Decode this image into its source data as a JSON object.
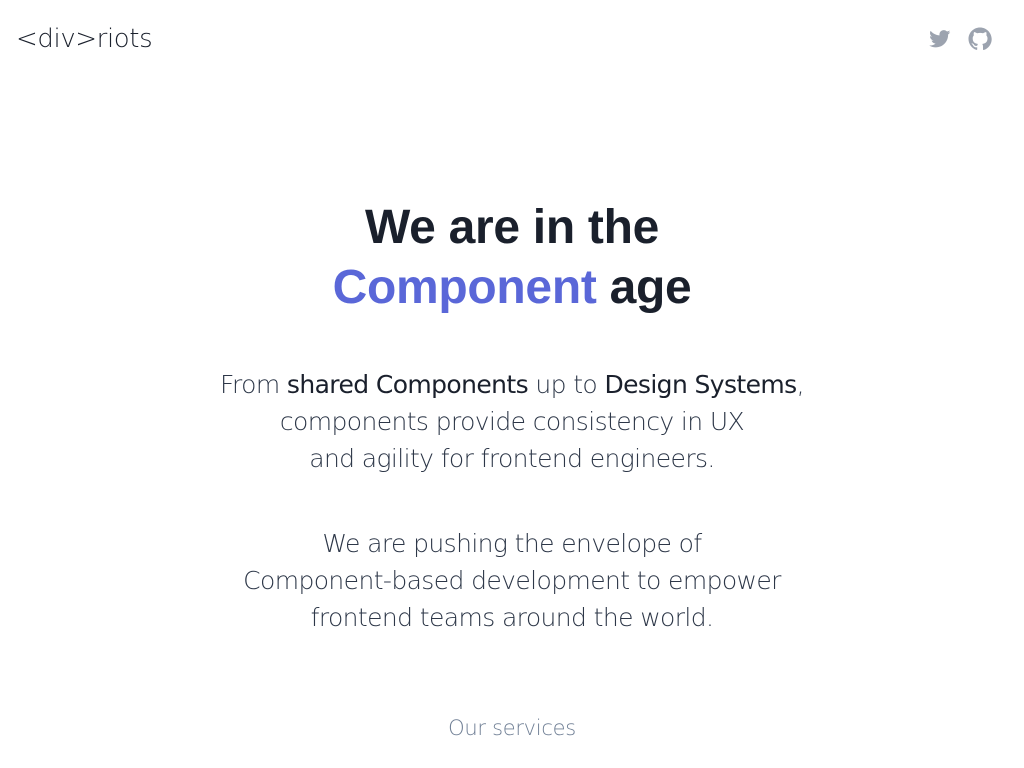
{
  "header": {
    "logo_text": "<div>riots",
    "social": [
      {
        "icon": "twitter-icon"
      },
      {
        "icon": "github-icon"
      }
    ]
  },
  "hero": {
    "headline_line1": "We are in the",
    "headline_accent": "Component",
    "headline_rest": " age",
    "accent_color": "#5a67d8"
  },
  "lead": {
    "l1_a": "From ",
    "l1_b": "shared Components",
    "l1_c": " up to ",
    "l1_d": "Design Systems",
    "l1_e": ",",
    "l2": "components provide consistency in UX",
    "l3": "and agility for frontend engineers."
  },
  "mission": {
    "l1": "We are pushing the envelope of",
    "l2": "Component-based development to empower",
    "l3": "frontend teams around the world."
  },
  "services": {
    "label": "Our services"
  }
}
